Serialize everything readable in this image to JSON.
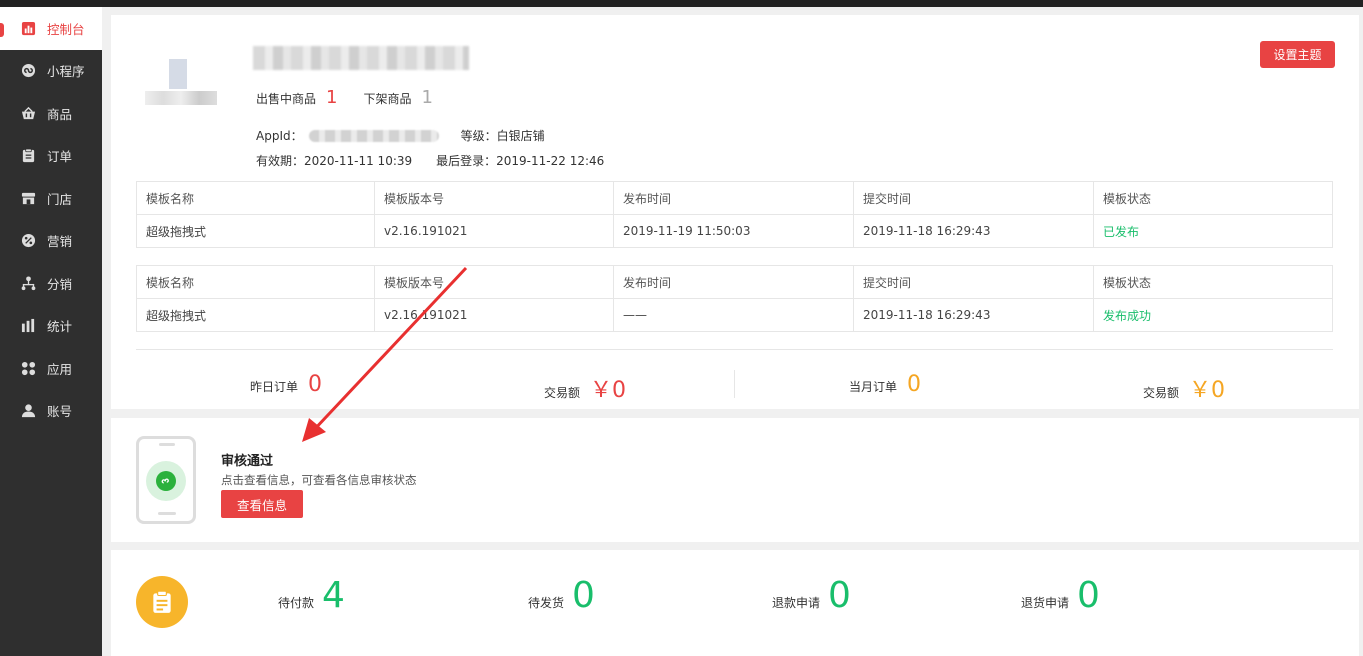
{
  "sidebar": {
    "items": [
      {
        "label": "控制台",
        "icon": "bar-chart-icon",
        "active": true
      },
      {
        "label": "小程序",
        "icon": "mini-program-icon",
        "active": false
      },
      {
        "label": "商品",
        "icon": "shopping-basket-icon",
        "active": false
      },
      {
        "label": "订单",
        "icon": "clipboard-icon",
        "active": false
      },
      {
        "label": "门店",
        "icon": "store-icon",
        "active": false
      },
      {
        "label": "营销",
        "icon": "percent-badge-icon",
        "active": false
      },
      {
        "label": "分销",
        "icon": "hierarchy-icon",
        "active": false
      },
      {
        "label": "统计",
        "icon": "stats-icon",
        "active": false
      },
      {
        "label": "应用",
        "icon": "apps-grid-icon",
        "active": false
      },
      {
        "label": "账号",
        "icon": "user-icon",
        "active": false
      }
    ]
  },
  "store": {
    "on_sale_label": "出售中商品",
    "on_sale_count": "1",
    "off_shelf_label": "下架商品",
    "off_shelf_count": "1",
    "appid_label": "AppId：",
    "level_label": "等级：白银店铺",
    "valid_label": "有效期：2020-11-11 10:39",
    "last_login_label": "最后登录：2019-11-22 12:46",
    "theme_button": "设置主题"
  },
  "tables": [
    {
      "headers": [
        "模板名称",
        "模板版本号",
        "发布时间",
        "提交时间",
        "模板状态"
      ],
      "row": [
        "超级拖拽式",
        "v2.16.191021",
        "2019-11-19 11:50:03",
        "2019-11-18 16:29:43",
        "已发布"
      ]
    },
    {
      "headers": [
        "模板名称",
        "模板版本号",
        "发布时间",
        "提交时间",
        "模板状态"
      ],
      "row": [
        "超级拖拽式",
        "v2.16.191021",
        "——",
        "2019-11-18 16:29:43",
        "发布成功"
      ]
    }
  ],
  "summary": {
    "yesterday_orders_label": "昨日订单",
    "yesterday_orders": "0",
    "yesterday_amount_label": "交易额",
    "yesterday_amount": "￥0",
    "month_orders_label": "当月订单",
    "month_orders": "0",
    "month_amount_label": "交易额",
    "month_amount": "￥0"
  },
  "audit": {
    "title": "审核通过",
    "desc": "点击查看信息，可查看各信息审核状态",
    "button": "查看信息"
  },
  "orders": {
    "pending_pay_label": "待付款",
    "pending_pay": "4",
    "pending_ship_label": "待发货",
    "pending_ship": "0",
    "refund_label": "退款申请",
    "refund": "0",
    "return_label": "退货申请",
    "return": "0"
  },
  "colors": {
    "accent": "#e84343",
    "success": "#19be6b",
    "warning": "#f5a623",
    "sidebar_bg": "#2f2f2f"
  }
}
